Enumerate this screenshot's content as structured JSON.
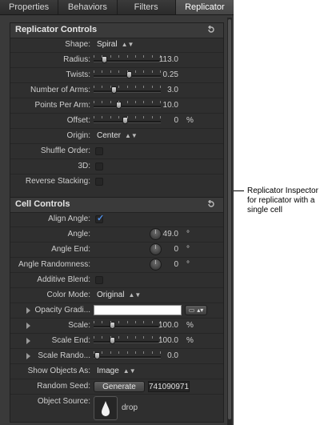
{
  "tabs": [
    "Properties",
    "Behaviors",
    "Filters",
    "Replicator"
  ],
  "active_tab": "Replicator",
  "replicator_controls": {
    "title": "Replicator Controls",
    "shape": {
      "label": "Shape:",
      "value": "Spiral"
    },
    "radius": {
      "label": "Radius:",
      "value": "113.0",
      "level": 0.12
    },
    "twists": {
      "label": "Twists:",
      "value": "0.25",
      "level": 0.52
    },
    "arms": {
      "label": "Number of Arms:",
      "value": "3.0",
      "level": 0.28
    },
    "points": {
      "label": "Points Per Arm:",
      "value": "10.0",
      "level": 0.36
    },
    "offset": {
      "label": "Offset:",
      "value": "0",
      "unit": "%",
      "level": 0.46
    },
    "origin": {
      "label": "Origin:",
      "value": "Center"
    },
    "shuffle": {
      "label": "Shuffle Order:",
      "checked": false
    },
    "threeD": {
      "label": "3D:",
      "checked": false
    },
    "reverse": {
      "label": "Reverse Stacking:",
      "checked": false
    }
  },
  "cell_controls": {
    "title": "Cell Controls",
    "align_angle": {
      "label": "Align Angle:",
      "checked": true,
      "check_glyph": "✓"
    },
    "angle": {
      "label": "Angle:",
      "value": "49.0",
      "unit": "°"
    },
    "angle_end": {
      "label": "Angle End:",
      "value": "0",
      "unit": "°"
    },
    "angle_random": {
      "label": "Angle Randomness:",
      "value": "0",
      "unit": "°"
    },
    "additive": {
      "label": "Additive Blend:",
      "checked": false
    },
    "color_mode": {
      "label": "Color Mode:",
      "value": "Original"
    },
    "opacity": {
      "label": "Opacity Gradi...",
      "swatch": "#ffffff"
    },
    "scale": {
      "label": "Scale:",
      "value": "100.0",
      "unit": "%",
      "level": 0.25
    },
    "scale_end": {
      "label": "Scale End:",
      "value": "100.0",
      "unit": "%",
      "level": 0.25
    },
    "scale_random": {
      "label": "Scale Rando...",
      "value": "0.0",
      "level": 0.0
    },
    "show_as": {
      "label": "Show Objects As:",
      "value": "Image"
    },
    "random_seed": {
      "label": "Random Seed:",
      "button": "Generate",
      "value": "741090971"
    },
    "object_source": {
      "label": "Object Source:",
      "value": "drop"
    }
  },
  "callout": "Replicator Inspector for replicator with a single cell",
  "colors": {
    "panel": "#3a3a3a",
    "section": "#2f2f2f",
    "accent": "#4f8ee8"
  }
}
